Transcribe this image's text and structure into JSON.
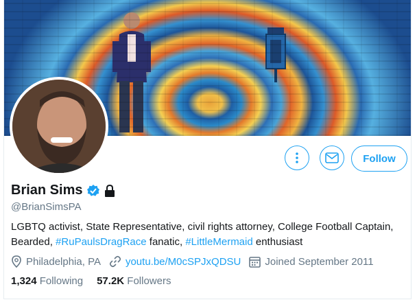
{
  "profile": {
    "name": "Brian Sims",
    "handle": "@BrianSimsPA",
    "bio": {
      "part1": "LGBTQ activist, State Representative, civil rights attorney, College Football Captain, Bearded, ",
      "hashtag1": "#RuPaulsDragRace",
      "part2": " fanatic, ",
      "hashtag2": "#LittleMermaid",
      "part3": " enthusiast"
    },
    "location": "Philadelphia, PA",
    "website": "youtu.be/M0cSPJxQDSU",
    "joined": "Joined September 2011",
    "stats": {
      "following_count": "1,324",
      "following_label": "Following",
      "followers_count": "57.2K",
      "followers_label": "Followers"
    }
  },
  "actions": {
    "follow_label": "Follow"
  },
  "icons": [
    "more-icon",
    "mail-icon",
    "verified-badge-icon",
    "lock-icon",
    "location-pin-icon",
    "link-icon",
    "calendar-icon"
  ],
  "colors": {
    "accent": "#1da1f2",
    "secondary_text": "#657786",
    "primary_text": "#14171a"
  }
}
